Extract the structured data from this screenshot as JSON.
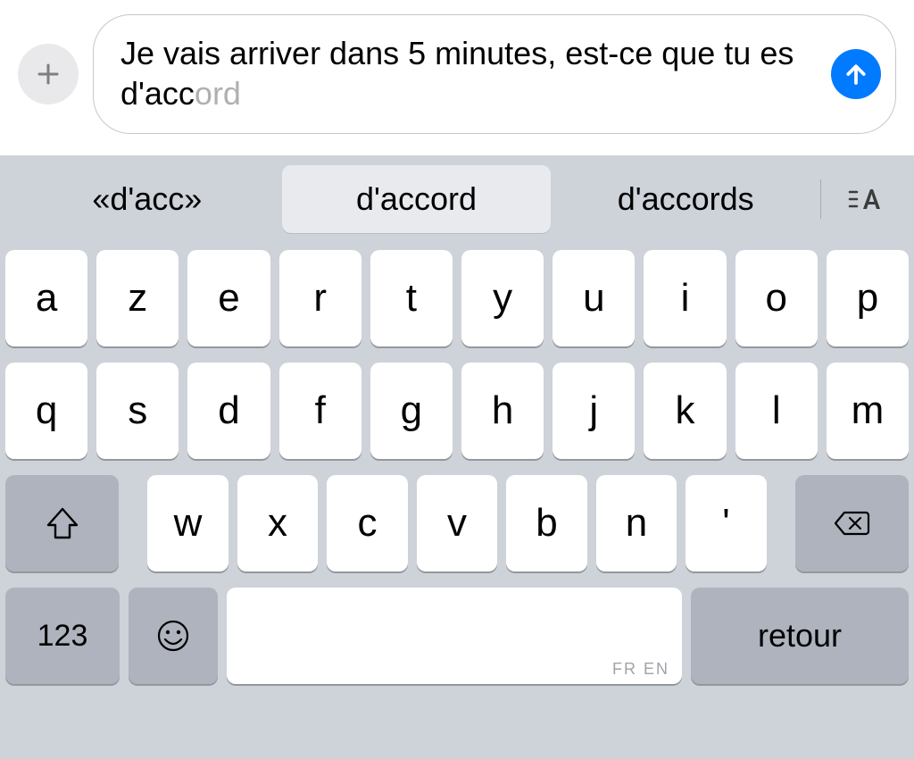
{
  "input": {
    "typed_text": "Je vais arriver dans 5 minutes, est-ce que tu es d'acc",
    "predicted_suffix": "ord"
  },
  "suggestions": {
    "left": "«d'acc»",
    "center": "d'accord",
    "right": "d'accords"
  },
  "keyboard": {
    "row1": [
      "a",
      "z",
      "e",
      "r",
      "t",
      "y",
      "u",
      "i",
      "o",
      "p"
    ],
    "row2": [
      "q",
      "s",
      "d",
      "f",
      "g",
      "h",
      "j",
      "k",
      "l",
      "m"
    ],
    "row3": [
      "w",
      "x",
      "c",
      "v",
      "b",
      "n",
      "'"
    ],
    "number_key": "123",
    "return_key": "retour",
    "space_locale": "FR EN"
  }
}
